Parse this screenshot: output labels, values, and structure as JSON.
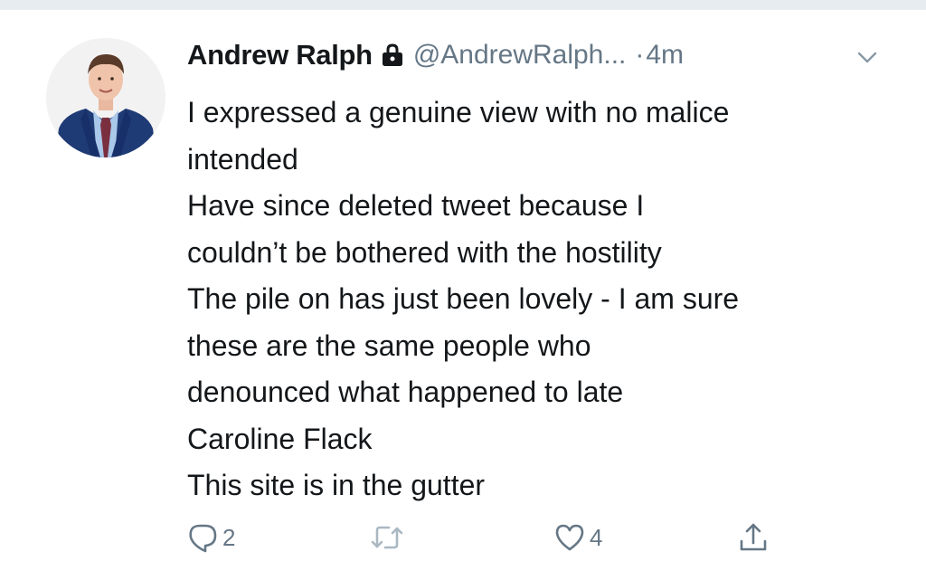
{
  "tweet": {
    "display_name": "Andrew Ralph",
    "handle": "@AndrewRalph...",
    "dot": "·",
    "time": "4m",
    "protected_icon": "lock-icon",
    "menu_icon": "chevron-down-icon",
    "body_lines": [
      "I expressed a genuine view with no malice",
      "intended",
      "Have since deleted tweet because I",
      "couldn’t be bothered with the hostility",
      "The pile on has just been lovely - I am sure",
      "these are the same people who",
      "denounced what happened to late",
      "Caroline Flack",
      "This site is in the gutter"
    ]
  },
  "actions": {
    "reply_icon": "reply-icon",
    "reply_count": "2",
    "retweet_icon": "retweet-icon",
    "like_icon": "heart-icon",
    "like_count": "4",
    "share_icon": "share-icon"
  },
  "colors": {
    "text": "#14171a",
    "secondary": "#657786",
    "top_strip": "#e6ecf0"
  }
}
